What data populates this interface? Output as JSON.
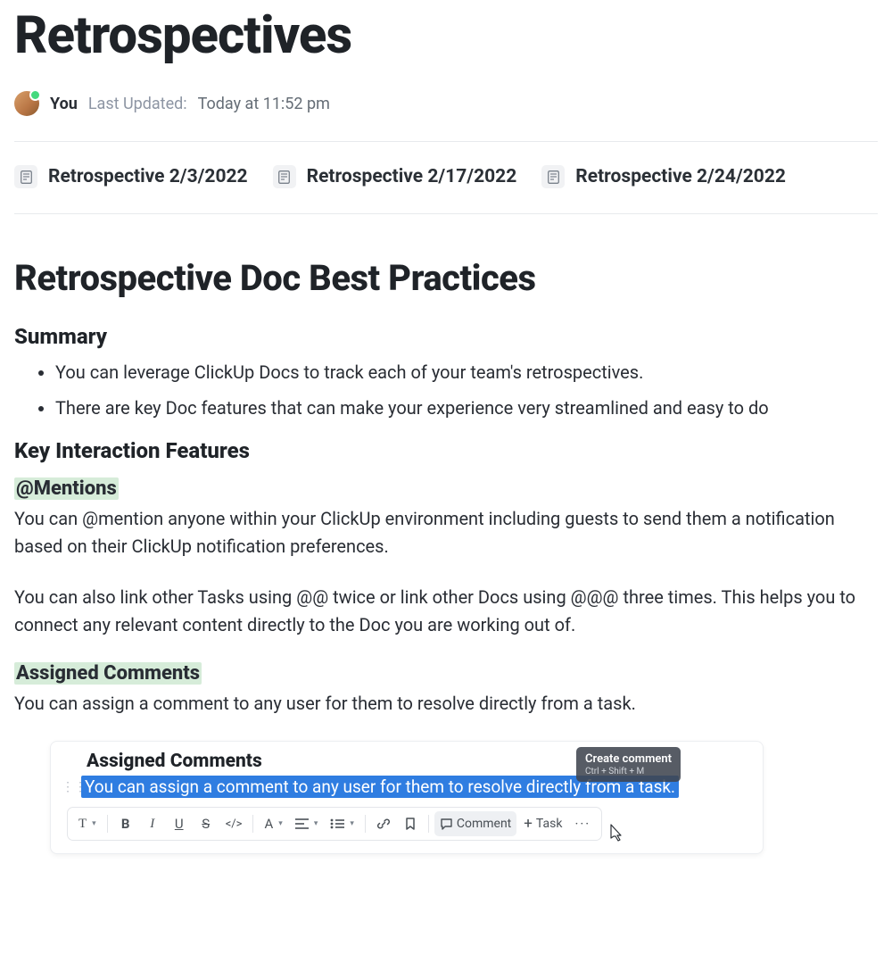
{
  "title": "Retrospectives",
  "author": "You",
  "updated_label": "Last Updated:",
  "updated_time": "Today at 11:52 pm",
  "subpages": [
    "Retrospective 2/3/2022",
    "Retrospective 2/17/2022",
    "Retrospective 2/24/2022"
  ],
  "section_heading": "Retrospective Doc Best Practices",
  "summary_heading": "Summary",
  "summary_items": [
    "You can leverage ClickUp Docs to track each of your team's retrospectives.",
    "There are key Doc features that can make your experience very streamlined and easy to do"
  ],
  "key_features_heading": "Key Interaction Features",
  "mentions": {
    "heading": "@Mentions",
    "p1": "You can @mention anyone within your ClickUp environment including guests to send them a notification based on their ClickUp notification preferences.",
    "p2": "You can also link other Tasks using @@ twice or link other Docs using @@@ three times.  This helps you to connect any relevant content directly to the Doc you are working out of."
  },
  "assigned": {
    "heading": "Assigned Comments",
    "p": "You can assign a comment to any user for them to resolve directly from a task."
  },
  "embed": {
    "title": "Assigned Comments",
    "highlighted_text": "You can assign a comment to any user for them to resolve directly from a task.",
    "tooltip_title": "Create comment",
    "tooltip_sub": "Ctrl + Shift + M",
    "toolbar": {
      "text_style": "T",
      "bold": "B",
      "italic": "I",
      "underline": "U",
      "strike": "S",
      "code": "</>",
      "font": "A",
      "comment_label": "Comment",
      "task_label": "Task"
    }
  }
}
